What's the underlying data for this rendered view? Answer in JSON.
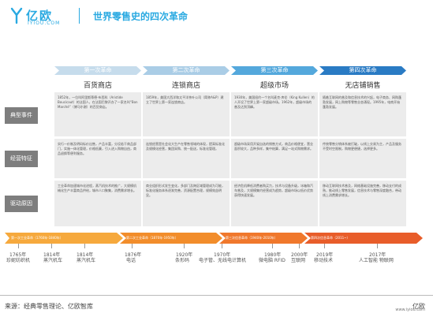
{
  "header": {
    "logo_cn": "亿欧",
    "logo_en": "IYIOU.COM",
    "title": "世界零售史的四次革命"
  },
  "colors": {
    "brand": "#29a9e1",
    "rev1": "#c6dcec",
    "rev2": "#aacde6",
    "rev3": "#54a8dc",
    "rev4": "#2a7bc4",
    "timeline1": "#f6a93d",
    "timeline2": "#f28d2b",
    "timeline3": "#f0782c",
    "timeline4": "#e85d2a",
    "row_label_bg": "#7e7e7e",
    "cell_bg": "#ececec"
  },
  "revolutions": [
    {
      "banner": "第一次革命",
      "name": "百货商店"
    },
    {
      "banner": "第二次革命",
      "name": "连锁商店"
    },
    {
      "banner": "第三次革命",
      "name": "超级市场"
    },
    {
      "banner": "第四次革命",
      "name": "无店铺销售"
    }
  ],
  "rows": [
    {
      "label": "典型事件",
      "cells": [
        "1852年，一位叫阿里斯蒂德·布西科（Aristide Boucicaut）的法国人，在法国巴黎开办了一家名叫“Bon Marché”（博马尔谢）的百货商店。",
        "1859年，美国大西洋和太平洋茶叶公司（简称A&P）建立了世界上第一家连锁商店。",
        "1930年，美国纽约一个名叫麦克·库伦（King Kullen）的人开设了世界上第一家超级市场。1962年，超级市场的普及达到顶峰。",
        "随着互联网的普及和信息技术的兴起，电子商务、网购蓬勃发展，网上购物等零售业态涌现。1995年，电商开始蓬勃发展。"
      ]
    },
    {
      "label": "经营特征",
      "cells": [
        "实行一价制及明码标价出售，产品丰富，分设若干商品部门，实施一体化管理，价格低廉，引入进入购物自由，商品退换等便利服务。",
        "连锁经营是社会化大生产在零售领域的体现，提高标准化及规模化经营，集团采购、统一配送，标准化管理。",
        "超级市场采用开架自选的销售方式，商品价格便宜，营业面积较大，品种多样，集中结算，满足一站式购物需求。",
        "传统零售分销体系被打破，以线上交易为主，产品及服务不受时空限制，购物更便捷，选择更多。"
      ]
    },
    {
      "label": "驱动原因",
      "cells": [
        "工业革命加速城市化进程，蒸汽机技术的推广，大规模机械化生产丰富商品供给，城市人口聚集，消费需求增长。",
        "商业组织形式发生变化，多部门及跨区域管理成为可能，标准化服务体系逐渐完善，资源配置合理，规模效益明显。",
        "经济危机降低消费者购买力，技术与设备升级，冰箱和汽车普及，大规模集约经营成为趋势，超级市场以低价优势获得快速发展。",
        "移动互联网技术普及，网络基础设施完善，移动支付的成熟，推动线上零售发展，信息技术与零售深度融合，带动线上消费需求增长。"
      ]
    }
  ],
  "timeline_segments": [
    {
      "label": "第一次工业革命（1760年-1840年）"
    },
    {
      "label": "第二次工业革命（1870年-1950年）"
    },
    {
      "label": "第三次信息革命（1940年-2010年）"
    },
    {
      "label": "第四次信息革命（2011~）"
    }
  ],
  "events": [
    {
      "year": "1765年",
      "label": "珍妮纺织机"
    },
    {
      "year": "1814年",
      "label": "蒸汽机车"
    },
    {
      "year": "1814年",
      "label": "蒸汽机车"
    },
    {
      "year": "1876年",
      "label": "电话"
    },
    {
      "year": "1920年",
      "label": "条形码"
    },
    {
      "year": "1970年",
      "label": "电子管、无线电计算机"
    },
    {
      "year": "1980年",
      "label": "微电脑 RFID"
    },
    {
      "year": "2000年",
      "label": "互联网"
    },
    {
      "year": "2019年",
      "label": "移动技术"
    },
    {
      "year": "2017年",
      "label": "人工智能 物联网"
    }
  ],
  "footer": {
    "source": "来源：经典零售理论、亿欧智库",
    "brand": "亿欧",
    "url": "www.iyiou.com"
  }
}
